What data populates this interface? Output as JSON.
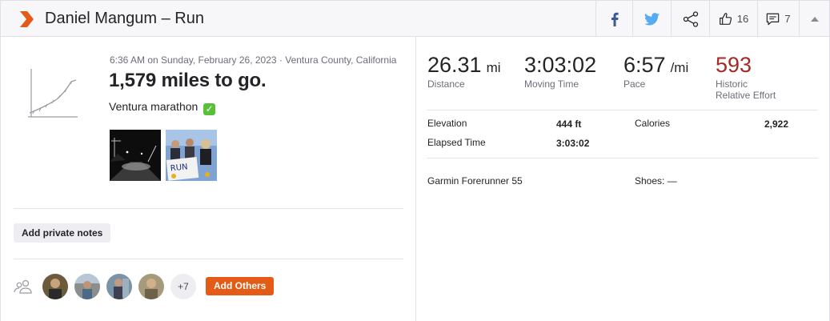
{
  "header": {
    "title": "Daniel Mangum – Run",
    "kudos_count": "16",
    "comments_count": "7"
  },
  "activity": {
    "datetime": "6:36 AM on Sunday, February 26, 2023 · Ventura County, California",
    "name": "1,579 miles to go.",
    "description": "Ventura marathon",
    "description_emoji": "✓",
    "private_notes_label": "Add private notes",
    "more_participants": "+7",
    "add_others_label": "Add Others"
  },
  "stats": {
    "distance": {
      "value": "26.31",
      "unit": "mi",
      "label": "Distance"
    },
    "moving_time": {
      "value": "3:03:02",
      "label": "Moving Time"
    },
    "pace": {
      "value": "6:57",
      "unit": "/mi",
      "label": "Pace"
    },
    "relative_effort": {
      "value": "593",
      "label_line1": "Historic",
      "label_line2": "Relative Effort"
    }
  },
  "details": {
    "elevation_label": "Elevation",
    "elevation_value": "444 ft",
    "calories_label": "Calories",
    "calories_value": "2,922",
    "elapsed_label": "Elapsed Time",
    "elapsed_value": "3:03:02",
    "device": "Garmin Forerunner 55",
    "shoes": "Shoes: —"
  },
  "colors": {
    "brand_orange": "#e35b17",
    "effort_red": "#a52a22",
    "facebook_blue": "#3b5998",
    "twitter_blue": "#55acee"
  }
}
